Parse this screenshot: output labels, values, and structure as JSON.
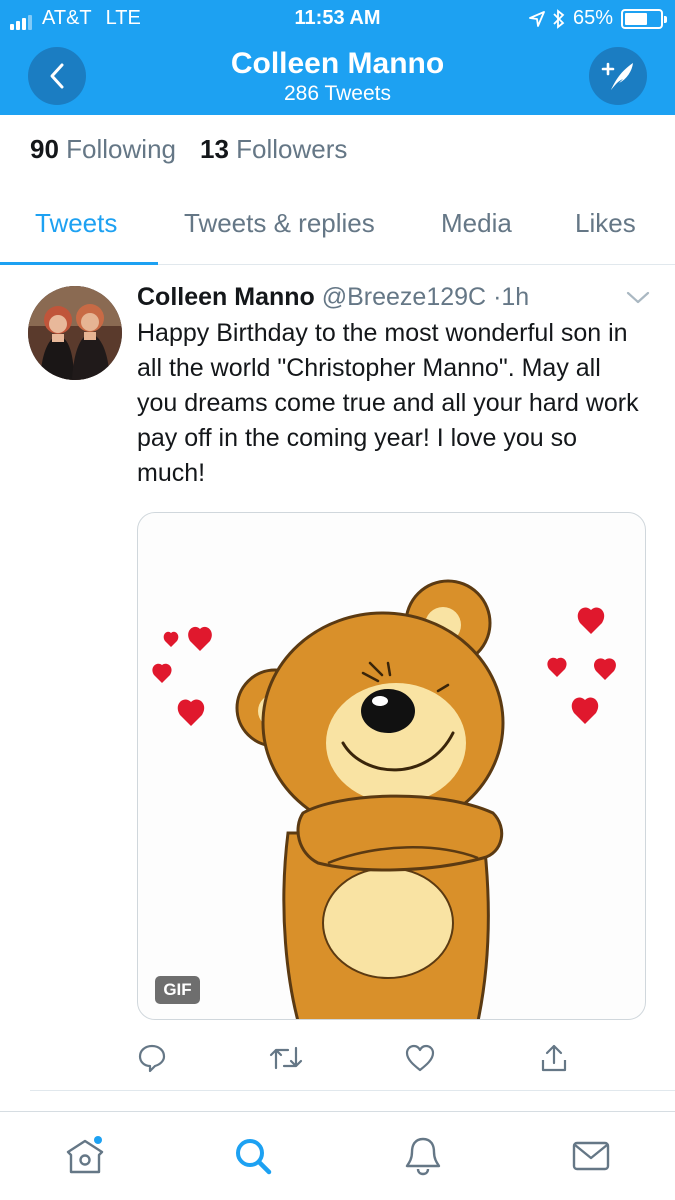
{
  "status_bar": {
    "carrier": "AT&T",
    "network": "LTE",
    "time": "11:53 AM",
    "battery": "65%",
    "battery_level": 0.65
  },
  "header": {
    "name": "Colleen Manno",
    "tweets_count": "286 Tweets",
    "background_color": "#1da1f2"
  },
  "stats": {
    "following_count": "90",
    "following_label": "Following",
    "followers_count": "13",
    "followers_label": "Followers"
  },
  "tabs": [
    {
      "label": "Tweets",
      "active": true
    },
    {
      "label": "Tweets & replies",
      "active": false
    },
    {
      "label": "Media",
      "active": false
    },
    {
      "label": "Likes",
      "active": false
    }
  ],
  "tweet": {
    "author_name": "Colleen Manno",
    "handle": "@Breeze129C",
    "separator": "·",
    "time": "1h",
    "text": "Happy Birthday to the most wonderful son in all the world \"Christopher Manno\". May all you dreams come true and all your hard work pay off in the coming year! I love you so much!",
    "media_badge": "GIF"
  },
  "tweet_actions": [
    "reply-icon",
    "retweet-icon",
    "like-icon",
    "share-icon"
  ],
  "bottom_nav": [
    "home-icon",
    "search-icon",
    "notifications-icon",
    "messages-icon"
  ],
  "colors": {
    "accent": "#1da1f2",
    "secondary_text": "#657786",
    "bear": "#d9902a",
    "heart": "#e0182d"
  }
}
